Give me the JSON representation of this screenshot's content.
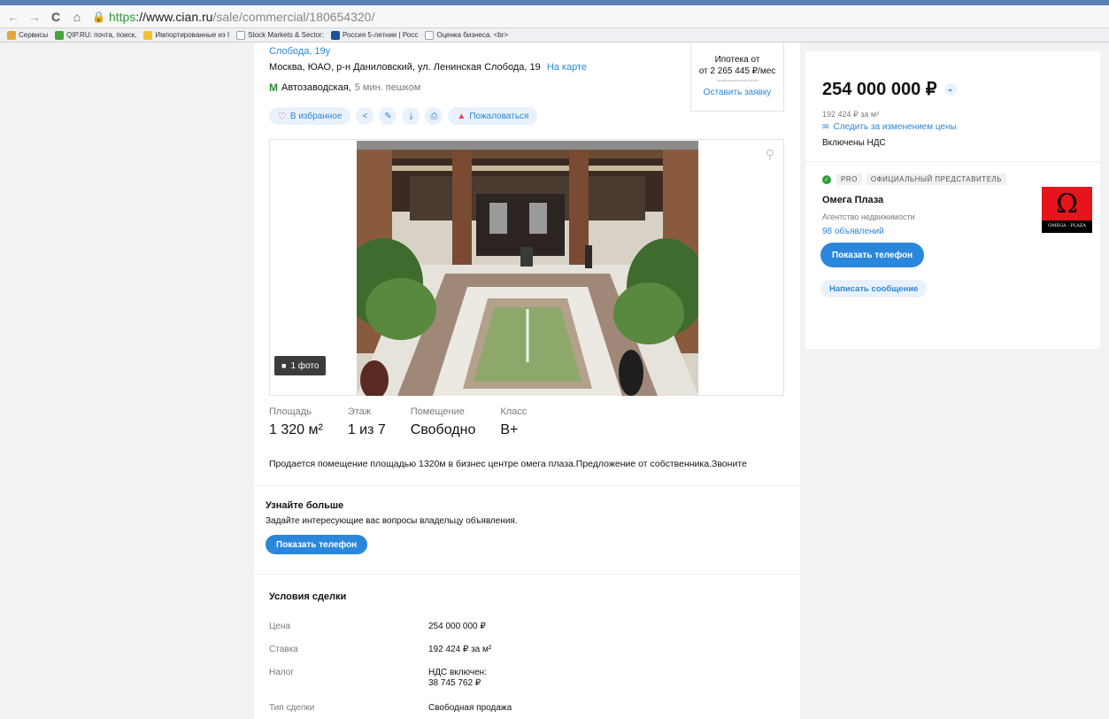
{
  "browser": {
    "url_secure": "https",
    "url_host": "://www.cian.ru",
    "url_path": "/sale/commercial/180654320/",
    "bookmarks": [
      {
        "label": "Сервисы",
        "color": "#e8a33b"
      },
      {
        "label": "QIP.RU: почта, поиск,",
        "color": "#48a23f"
      },
      {
        "label": "Импортированные из I",
        "color": "#f2c233"
      },
      {
        "label": "Stock Markets & Sector:",
        "color": "#9aa3ad"
      },
      {
        "label": "Россия 5-летние | Росс",
        "color": "#1c4f9c"
      },
      {
        "label": "Оценка бизнеса. <br>",
        "color": "#9aa3ad"
      }
    ]
  },
  "listing": {
    "address_top": "Слобода, 19у",
    "address": "Москва, ЮАО, р-н Даниловский, ул. Ленинская Слобода, 19",
    "map_link": "На карте",
    "metro_station": "Автозаводская,",
    "metro_time": "5 мин. пешком",
    "favorite_label": "В избранное",
    "report_label": "Пожаловаться",
    "photo_count": "1 фото",
    "stats": [
      {
        "label": "Площадь",
        "value": "1 320 м²"
      },
      {
        "label": "Этаж",
        "value": "1 из 7"
      },
      {
        "label": "Помещение",
        "value": "Свободно"
      },
      {
        "label": "Класс",
        "value": "B+"
      }
    ],
    "description": "Продается помещение площадью 1320м в бизнес центре омега плаза.Предложение от собственника.Звоните"
  },
  "mortgage": {
    "title": "Ипотека от",
    "amount": "от 2 265 445 ₽/мес",
    "note": "*предварительный расчёт",
    "link": "Оставить заявку"
  },
  "learn_more": {
    "title": "Узнайте больше",
    "subtitle": "Задайте интересующие вас вопросы владельцу объявления.",
    "button": "Показать телефон"
  },
  "deal": {
    "title": "Условия сделки",
    "rows": [
      {
        "key": "Цена",
        "value": "254 000 000 ₽"
      },
      {
        "key": "Ставка",
        "value": "192 424 ₽ за м²"
      },
      {
        "key": "Налог",
        "value": "НДС включен:",
        "value2": "38 745 762 ₽"
      },
      {
        "key": "Тип сделки",
        "value": "Свободная продажа"
      }
    ]
  },
  "sidebar": {
    "price": "254 000 000 ₽",
    "price_per_m": "192 424 ₽ за м²",
    "follow_price": "Следить за изменением цены",
    "vat": "Включены НДС",
    "pro": "PRO",
    "official": "ОФИЦИАЛЬНЫЙ ПРЕДСТАВИТЕЛЬ",
    "agency": "Омега Плаза",
    "agency_type": "Агентство недвижимости",
    "listings": "98 объявлений",
    "logo_symbol": "Ω",
    "logo_text": "OMEGA - PLAZA",
    "phone_button": "Показать телефон",
    "message_button": "Написать сообщение"
  },
  "colors": {
    "accent": "#2b87db",
    "accent_light": "#e9f2fc",
    "favorite": "#e84260",
    "metro": "#2e8b2e",
    "logo_red": "#e8141c"
  }
}
